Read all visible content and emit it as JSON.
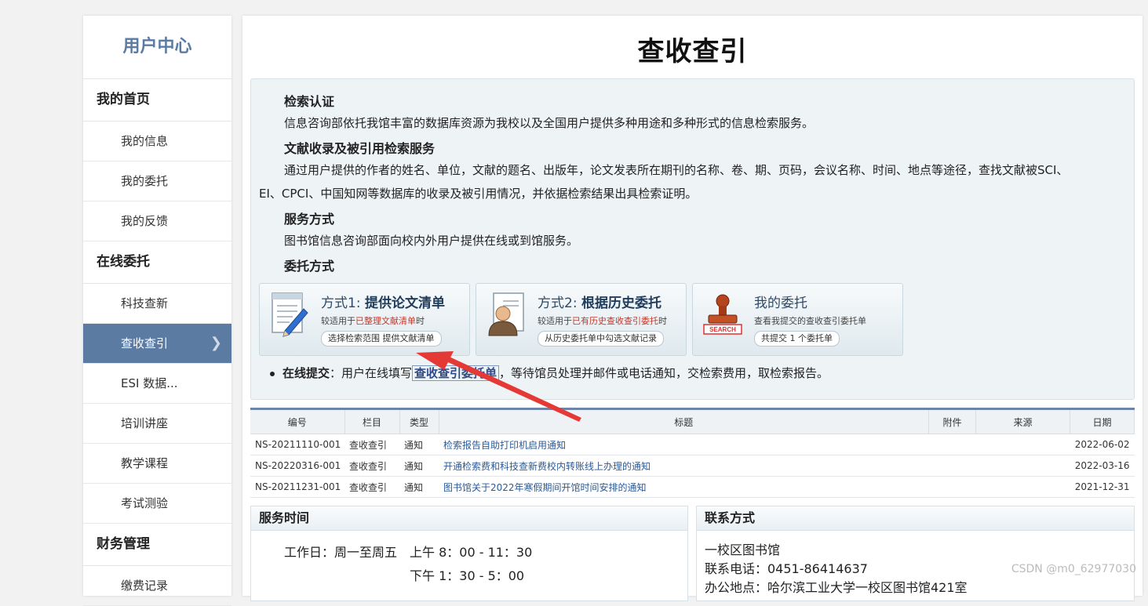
{
  "sidebar": {
    "title": "用户中心",
    "groups": [
      {
        "label": "我的首页"
      },
      {
        "label": "在线委托"
      },
      {
        "label": "财务管理"
      }
    ],
    "items": [
      {
        "label": "我的信息"
      },
      {
        "label": "我的委托"
      },
      {
        "label": "我的反馈"
      },
      {
        "label": "科技查新"
      },
      {
        "label": "查收查引"
      },
      {
        "label": "ESI 数据..."
      },
      {
        "label": "培训讲座"
      },
      {
        "label": "教学课程"
      },
      {
        "label": "考试测验"
      },
      {
        "label": "缴费记录"
      }
    ]
  },
  "main": {
    "title": "查收查引",
    "intro": {
      "h1": "检索认证",
      "p1": "信息咨询部依托我馆丰富的数据库资源为我校以及全国用户提供多种用途和多种形式的信息检索服务。",
      "h2": "文献收录及被引用检索服务",
      "p2a": "通过用户提供的作者的姓名、单位，文献的题名、出版年，论文发表所在期刊的名称、卷、期、页码，会议名称、时间、地点等途径，查找文献被SCI、",
      "p2b": "EI、CPCI、中国知网等数据库的收录及被引用情况，并依据检索结果出具检索证明。",
      "h3": "服务方式",
      "p3": "图书馆信息咨询部面向校内外用户提供在线或到馆服务。",
      "h4": "委托方式"
    },
    "cards": [
      {
        "prefix": "方式1: ",
        "title": "提供论文清单",
        "sub_pre": "较适用于",
        "sub_red": "已整理文献清单",
        "sub_post": "时",
        "pill": "选择检索范围 提供文献清单"
      },
      {
        "prefix": "方式2: ",
        "title": "根据历史委托",
        "sub_pre": "较适用于",
        "sub_red": "已有历史查收查引委托",
        "sub_post": "时",
        "pill": "从历史委托单中勾选文献记录"
      },
      {
        "prefix": "",
        "title": "我的委托",
        "sub_pre": "查看我提交的查收查引委托单",
        "sub_red": "",
        "sub_post": "",
        "pill": "共提交 1 个委托单"
      }
    ],
    "online": {
      "label": "在线提交",
      "pre": "：用户在线填写",
      "link": "查收查引委托单",
      "post": "，等待馆员处理并邮件或电话通知，交检索费用，取检索报告。"
    },
    "table": {
      "headers": [
        "编号",
        "栏目",
        "类型",
        "标题",
        "附件",
        "来源",
        "日期"
      ],
      "rows": [
        {
          "id": "NS-20211110-001",
          "col": "查收查引",
          "type": "通知",
          "title": "检索报告自助打印机启用通知",
          "date": "2022-06-02"
        },
        {
          "id": "NS-20220316-001",
          "col": "查收查引",
          "type": "通知",
          "title": "开通检索费和科技查新费校内转账线上办理的通知",
          "date": "2022-03-16"
        },
        {
          "id": "NS-20211231-001",
          "col": "查收查引",
          "type": "通知",
          "title": "图书馆关于2022年寒假期间开馆时间安排的通知",
          "date": "2021-12-31"
        }
      ]
    },
    "service": {
      "title": "服务时间",
      "workday": "工作日：周一至周五",
      "am": "上午 8：00 - 11：30",
      "pm": "下午 1：30 - 5：00"
    },
    "contact": {
      "title": "联系方式",
      "l1": "一校区图书馆",
      "l2": "联系电话：0451-86414637",
      "l3": "办公地点：哈尔滨工业大学一校区图书馆421室"
    }
  },
  "watermark": "CSDN @m0_62977030",
  "colors": {
    "accent": "#5b7ba3",
    "link": "#2a5a9a",
    "arrow": "#e53935"
  }
}
